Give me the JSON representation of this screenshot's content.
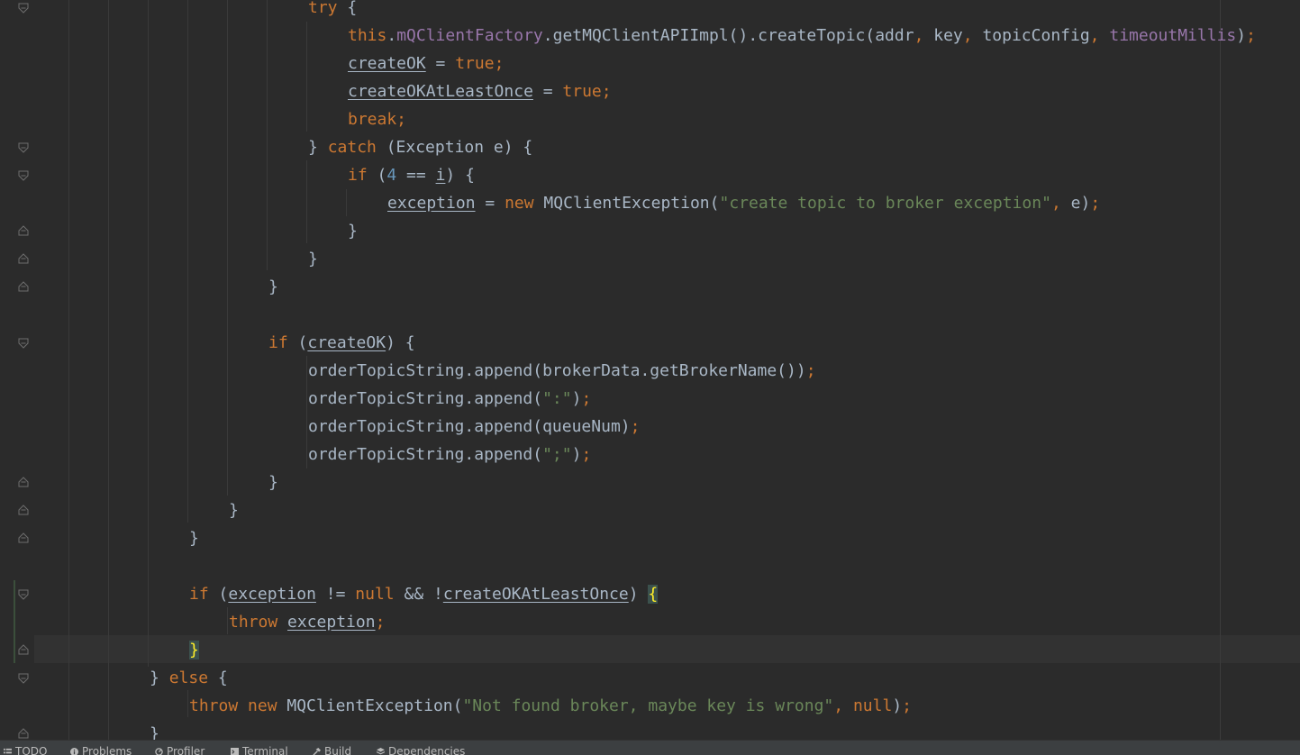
{
  "editor": {
    "lines": [
      {
        "html": "<span class=\"kw\">try</span> {"
      },
      {
        "html": "<span class=\"kw\">this</span>.<span class=\"fld\">mQClientFactory</span>.getMQClientAPIImpl().createTopic(addr<span class=\"kw\">,</span> key<span class=\"kw\">,</span> topicConfig<span class=\"kw\">,</span> <span class=\"fld\">timeoutMillis</span>)<span class=\"kw\">;</span>"
      },
      {
        "html": "<span class=\"u\">createOK</span> = <span class=\"kw\">true;</span>"
      },
      {
        "html": "<span class=\"u\">createOKAtLeastOnce</span> = <span class=\"kw\">true;</span>"
      },
      {
        "html": "<span class=\"kw\">break;</span>"
      },
      {
        "html": "} <span class=\"kw\">catch</span> (Exception e) {"
      },
      {
        "html": "<span class=\"kw\">if</span> (<span class=\"num\">4</span> == <span class=\"u\">i</span>) {"
      },
      {
        "html": "<span class=\"u\">exception</span> = <span class=\"kw\">new</span> MQClientException(<span class=\"str\">\"create topic to broker exception\"</span><span class=\"kw\">,</span> e)<span class=\"kw\">;</span>"
      },
      {
        "html": "}"
      },
      {
        "html": "}"
      },
      {
        "html": "}"
      },
      {
        "html": ""
      },
      {
        "html": "<span class=\"kw\">if</span> (<span class=\"u\">createOK</span>) {"
      },
      {
        "html": "orderTopicString.append(brokerData.getBrokerName())<span class=\"kw\">;</span>"
      },
      {
        "html": "orderTopicString.append(<span class=\"str\">\":\"</span>)<span class=\"kw\">;</span>"
      },
      {
        "html": "orderTopicString.append(queueNum)<span class=\"kw\">;</span>"
      },
      {
        "html": "orderTopicString.append(<span class=\"str\">\";\"</span>)<span class=\"kw\">;</span>"
      },
      {
        "html": "}"
      },
      {
        "html": "}"
      },
      {
        "html": "}"
      },
      {
        "html": ""
      },
      {
        "html": "<span class=\"kw\">if</span> (<span class=\"u\">exception</span> != <span class=\"kw\">null</span> &amp;&amp; !<span class=\"u\">createOKAtLeastOnce</span>) <span class=\"brace-hl\">{</span>"
      },
      {
        "html": "<span class=\"kw\">throw</span> <span class=\"u\">exception</span><span class=\"kw\">;</span>"
      },
      {
        "html": "<span class=\"brace-hl\">}</span>"
      },
      {
        "html": "} <span class=\"kw\">else</span> {"
      },
      {
        "html": "<span class=\"kw\">throw new</span> MQClientException(<span class=\"str\">\"Not found broker, maybe key is wrong\"</span><span class=\"kw\">,</span> <span class=\"kw\">null</span>)<span class=\"kw\">;</span>"
      },
      {
        "html": "}"
      }
    ]
  },
  "statusbar": {
    "todo": "TODO",
    "problems": "Problems",
    "profiler": "Profiler",
    "terminal": "Terminal",
    "build": "Build",
    "dependencies": "Dependencies"
  },
  "colors": {
    "background": "#2b2b2b",
    "keyword": "#cc7832",
    "field": "#9876aa",
    "string": "#6a8759",
    "number": "#6897bb",
    "text": "#a9b7c6"
  },
  "icons": {
    "todo": "list-icon",
    "problems": "info-icon",
    "profiler": "profiler-icon",
    "terminal": "terminal-icon",
    "build": "hammer-icon",
    "dependencies": "dependencies-icon"
  }
}
